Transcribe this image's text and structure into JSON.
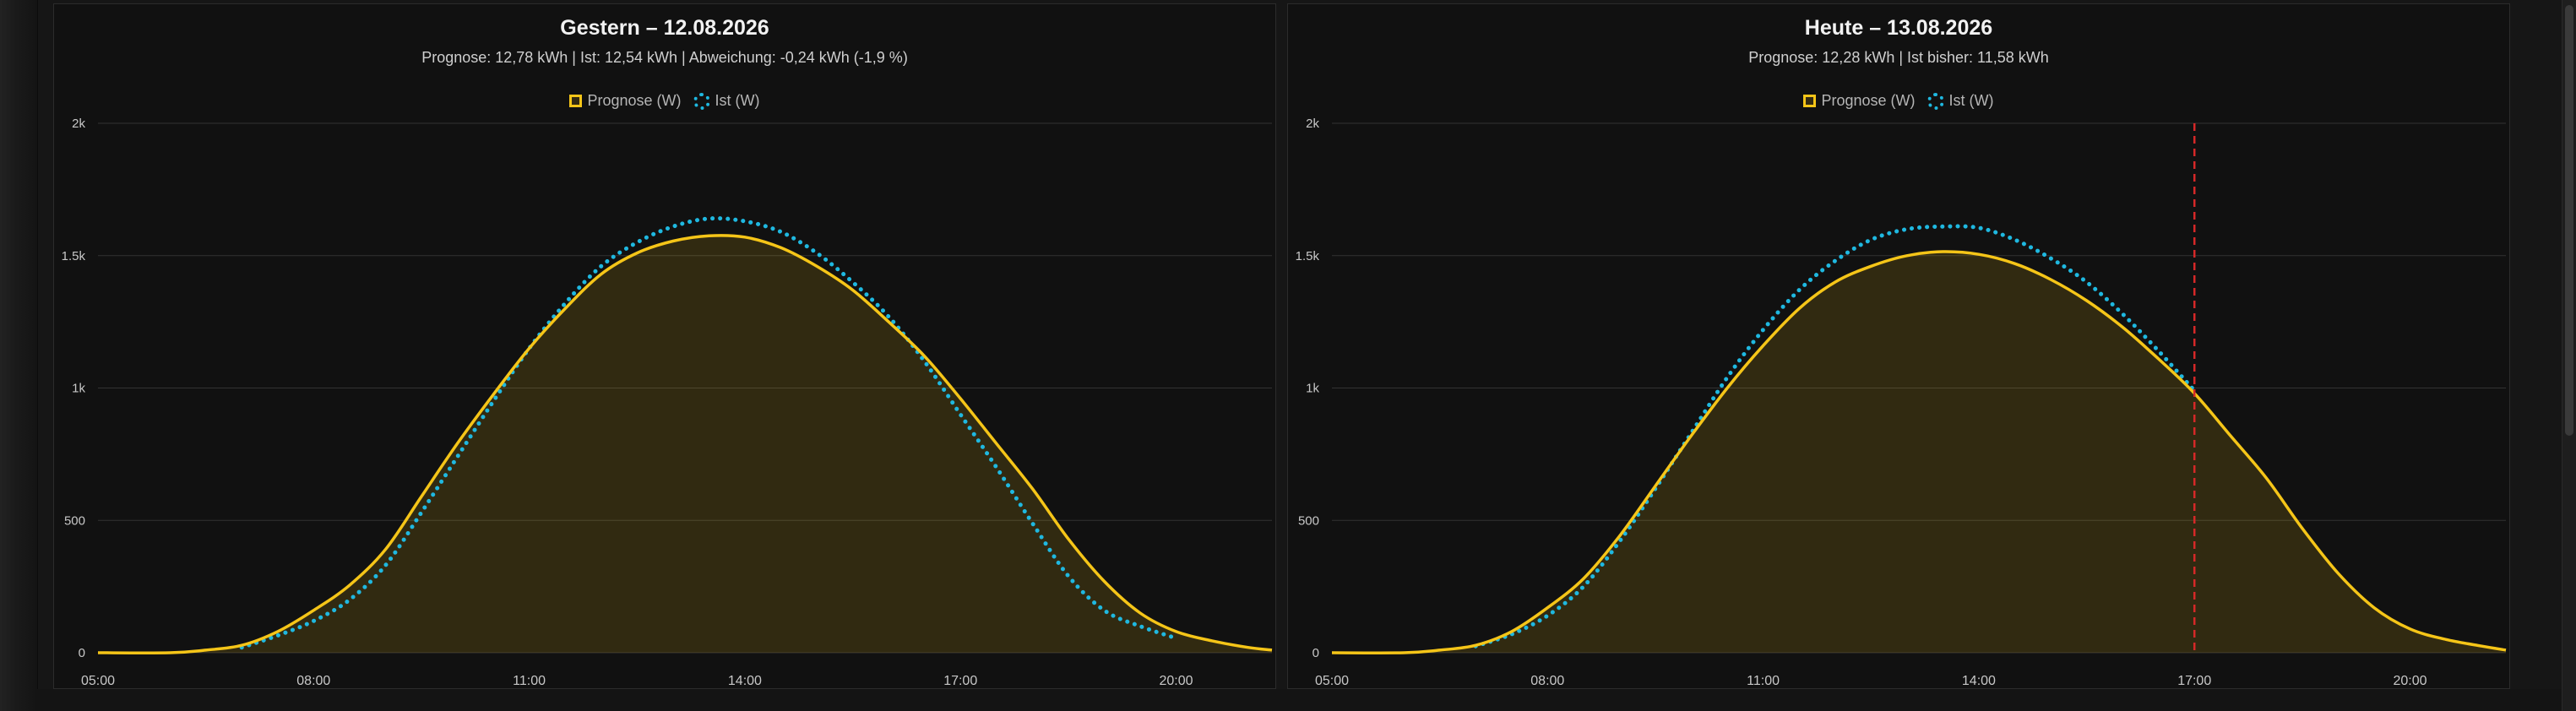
{
  "theme": {
    "forecast_color": "#f5c518",
    "actual_color": "#1fb8e0",
    "now_line_color": "#d62828",
    "grid_color": "#333333",
    "background": "#111111"
  },
  "chart_data": [
    {
      "type": "line",
      "title": "Gestern – 12.08.2026",
      "subtitle": "Prognose: 12,78 kWh | Ist: 12,54 kWh | Abweichung: -0,24 kWh (-1,9 %)",
      "xlabel": "",
      "ylabel": "",
      "xlim": [
        "05:00",
        "21:20"
      ],
      "ylim": [
        0,
        2000
      ],
      "x_ticks": [
        "05:00",
        "08:00",
        "11:00",
        "14:00",
        "17:00",
        "20:00"
      ],
      "y_ticks": [
        {
          "value": 0,
          "label": "0"
        },
        {
          "value": 500,
          "label": "500"
        },
        {
          "value": 1000,
          "label": "1k"
        },
        {
          "value": 1500,
          "label": "1.5k"
        },
        {
          "value": 2000,
          "label": "2k"
        }
      ],
      "grid": true,
      "legend_position": "top-center",
      "series": [
        {
          "name": "Prognose (W)",
          "style": "solid-area",
          "points": [
            [
              "05:00",
              0
            ],
            [
              "06:00",
              0
            ],
            [
              "06:30",
              10
            ],
            [
              "07:00",
              28
            ],
            [
              "07:30",
              80
            ],
            [
              "08:00",
              160
            ],
            [
              "08:30",
              255
            ],
            [
              "09:00",
              390
            ],
            [
              "09:30",
              590
            ],
            [
              "10:00",
              790
            ],
            [
              "10:30",
              975
            ],
            [
              "11:00",
              1150
            ],
            [
              "11:30",
              1300
            ],
            [
              "12:00",
              1430
            ],
            [
              "12:30",
              1510
            ],
            [
              "13:00",
              1555
            ],
            [
              "13:30",
              1575
            ],
            [
              "14:00",
              1570
            ],
            [
              "14:30",
              1530
            ],
            [
              "15:00",
              1460
            ],
            [
              "15:30",
              1370
            ],
            [
              "16:00",
              1250
            ],
            [
              "16:30",
              1120
            ],
            [
              "17:00",
              960
            ],
            [
              "17:30",
              790
            ],
            [
              "18:00",
              620
            ],
            [
              "18:30",
              430
            ],
            [
              "19:00",
              270
            ],
            [
              "19:30",
              150
            ],
            [
              "20:00",
              80
            ],
            [
              "20:30",
              45
            ],
            [
              "21:00",
              20
            ],
            [
              "21:20",
              10
            ]
          ]
        },
        {
          "name": "Ist (W)",
          "style": "dotted",
          "points": [
            [
              "07:00",
              20
            ],
            [
              "07:30",
              65
            ],
            [
              "08:00",
              120
            ],
            [
              "08:30",
              200
            ],
            [
              "09:00",
              330
            ],
            [
              "09:30",
              530
            ],
            [
              "10:00",
              740
            ],
            [
              "10:30",
              950
            ],
            [
              "11:00",
              1150
            ],
            [
              "11:30",
              1320
            ],
            [
              "12:00",
              1460
            ],
            [
              "12:30",
              1550
            ],
            [
              "13:00",
              1610
            ],
            [
              "13:30",
              1640
            ],
            [
              "14:00",
              1630
            ],
            [
              "14:30",
              1590
            ],
            [
              "15:00",
              1510
            ],
            [
              "15:30",
              1400
            ],
            [
              "16:00",
              1270
            ],
            [
              "16:30",
              1100
            ],
            [
              "17:00",
              900
            ],
            [
              "17:30",
              700
            ],
            [
              "18:00",
              490
            ],
            [
              "18:30",
              290
            ],
            [
              "19:00",
              160
            ],
            [
              "19:30",
              100
            ],
            [
              "20:00",
              55
            ]
          ]
        }
      ]
    },
    {
      "type": "line",
      "title": "Heute – 13.08.2026",
      "subtitle": "Prognose: 12,28 kWh | Ist bisher: 11,58 kWh",
      "xlabel": "",
      "ylabel": "",
      "xlim": [
        "05:00",
        "21:20"
      ],
      "ylim": [
        0,
        2000
      ],
      "x_ticks": [
        "05:00",
        "08:00",
        "11:00",
        "14:00",
        "17:00",
        "20:00"
      ],
      "y_ticks": [
        {
          "value": 0,
          "label": "0"
        },
        {
          "value": 500,
          "label": "500"
        },
        {
          "value": 1000,
          "label": "1k"
        },
        {
          "value": 1500,
          "label": "1.5k"
        },
        {
          "value": 2000,
          "label": "2k"
        }
      ],
      "grid": true,
      "legend_position": "top-center",
      "now_marker": "17:00",
      "series": [
        {
          "name": "Prognose (W)",
          "style": "solid-area",
          "points": [
            [
              "05:00",
              0
            ],
            [
              "06:00",
              0
            ],
            [
              "06:30",
              10
            ],
            [
              "07:00",
              28
            ],
            [
              "07:30",
              80
            ],
            [
              "08:00",
              170
            ],
            [
              "08:30",
              280
            ],
            [
              "09:00",
              440
            ],
            [
              "09:30",
              630
            ],
            [
              "10:00",
              820
            ],
            [
              "10:30",
              1000
            ],
            [
              "11:00",
              1160
            ],
            [
              "11:30",
              1300
            ],
            [
              "12:00",
              1400
            ],
            [
              "12:30",
              1460
            ],
            [
              "13:00",
              1500
            ],
            [
              "13:30",
              1515
            ],
            [
              "14:00",
              1505
            ],
            [
              "14:30",
              1470
            ],
            [
              "15:00",
              1410
            ],
            [
              "15:30",
              1330
            ],
            [
              "16:00",
              1230
            ],
            [
              "16:30",
              1110
            ],
            [
              "17:00",
              980
            ],
            [
              "17:30",
              820
            ],
            [
              "18:00",
              660
            ],
            [
              "18:30",
              470
            ],
            [
              "19:00",
              300
            ],
            [
              "19:30",
              170
            ],
            [
              "20:00",
              90
            ],
            [
              "20:30",
              50
            ],
            [
              "21:00",
              25
            ],
            [
              "21:20",
              10
            ]
          ]
        },
        {
          "name": "Ist (W)",
          "style": "dotted",
          "points": [
            [
              "07:00",
              25
            ],
            [
              "07:30",
              70
            ],
            [
              "08:00",
              140
            ],
            [
              "08:30",
              250
            ],
            [
              "09:00",
              420
            ],
            [
              "09:30",
              620
            ],
            [
              "10:00",
              830
            ],
            [
              "10:30",
              1040
            ],
            [
              "11:00",
              1220
            ],
            [
              "11:30",
              1370
            ],
            [
              "12:00",
              1480
            ],
            [
              "12:30",
              1560
            ],
            [
              "13:00",
              1600
            ],
            [
              "13:30",
              1610
            ],
            [
              "14:00",
              1605
            ],
            [
              "14:30",
              1560
            ],
            [
              "15:00",
              1490
            ],
            [
              "15:30",
              1400
            ],
            [
              "16:00",
              1280
            ],
            [
              "16:30",
              1140
            ],
            [
              "17:00",
              990
            ]
          ]
        }
      ]
    }
  ]
}
